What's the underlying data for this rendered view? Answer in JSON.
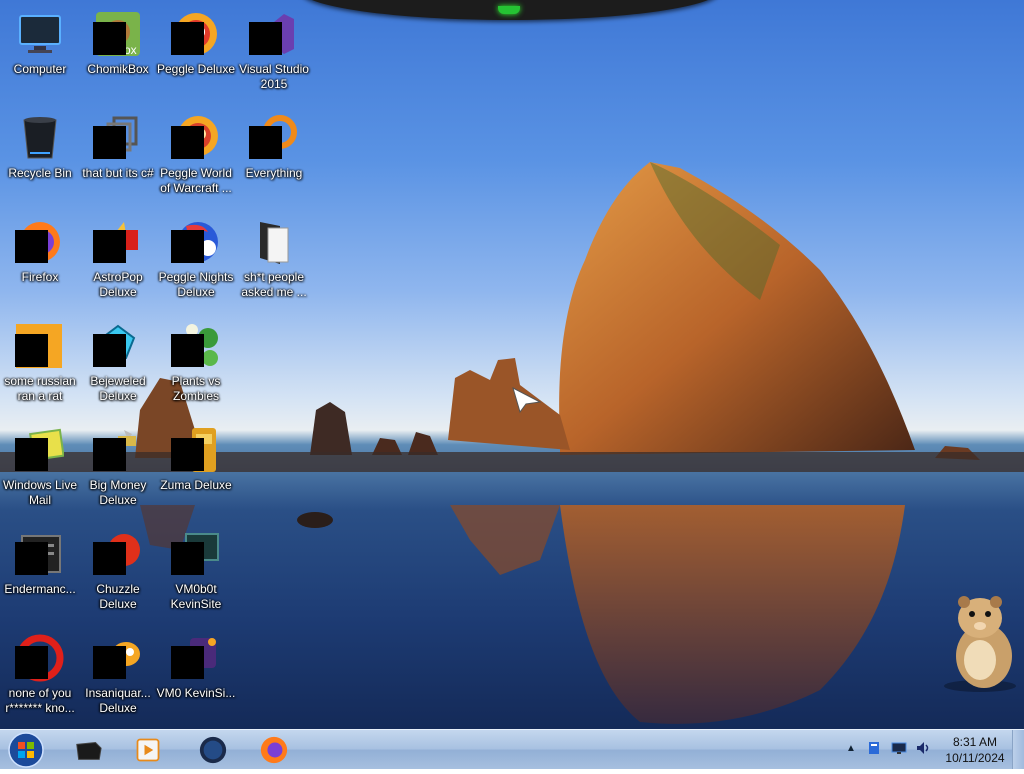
{
  "desktop": {
    "icons": [
      {
        "label": "Computer",
        "icon": "computer-monitor-icon"
      },
      {
        "label": "ChomikBox",
        "icon": "chomikbox-icon"
      },
      {
        "label": "Peggle Deluxe",
        "icon": "peggle-icon"
      },
      {
        "label": "Visual Studio 2015",
        "icon": "visual-studio-icon"
      },
      {
        "label": "Recycle Bin",
        "icon": "recycle-bin-icon"
      },
      {
        "label": "that but its c#",
        "icon": "shortcut-stack-icon"
      },
      {
        "label": "Peggle World of Warcraft ...",
        "icon": "peggle-wow-icon"
      },
      {
        "label": "Everything",
        "icon": "everything-search-icon"
      },
      {
        "label": "Firefox",
        "icon": "firefox-icon"
      },
      {
        "label": "AstroPop Deluxe",
        "icon": "astropop-icon"
      },
      {
        "label": "Peggle Nights Deluxe",
        "icon": "peggle-nights-icon"
      },
      {
        "label": "sh*t people asked me ...",
        "icon": "folder-icon"
      },
      {
        "label": "some russian ran a rat",
        "icon": "app-icon"
      },
      {
        "label": "Bejeweled Deluxe",
        "icon": "bejeweled-icon"
      },
      {
        "label": "Plants vs Zombies",
        "icon": "plants-vs-zombies-icon"
      },
      {
        "label": "Windows Live Mail",
        "icon": "windows-live-mail-icon"
      },
      {
        "label": "Big Money Deluxe",
        "icon": "big-money-icon"
      },
      {
        "label": "Zuma Deluxe",
        "icon": "zuma-icon"
      },
      {
        "label": "Endermanc...",
        "icon": "terminal-app-icon"
      },
      {
        "label": "Chuzzle Deluxe",
        "icon": "chuzzle-icon"
      },
      {
        "label": "VM0b0t KevinSite",
        "icon": "vm-app-icon"
      },
      {
        "label": "none of you r******* kno...",
        "icon": "opera-icon"
      },
      {
        "label": "Insaniquar... Deluxe",
        "icon": "insaniquarium-icon"
      },
      {
        "label": "VM0 KevinSi...",
        "icon": "vm-purple-icon"
      }
    ]
  },
  "taskbar": {
    "start": "windows-start-orb-icon",
    "pinned": [
      {
        "name": "black-box-app-icon"
      },
      {
        "name": "media-player-icon"
      },
      {
        "name": "globe-app-icon"
      },
      {
        "name": "firefox-icon"
      }
    ],
    "tray": {
      "show_hidden": "▲",
      "icons": [
        "action-center-flag-icon",
        "network-icon",
        "volume-icon"
      ],
      "time": "8:31 AM",
      "date": "10/11/2024"
    }
  },
  "colors": {
    "sky": "#4a84dc",
    "sea": "#1d3b73",
    "rock": "#c5702a",
    "taskbar": "#a8c1e1"
  }
}
